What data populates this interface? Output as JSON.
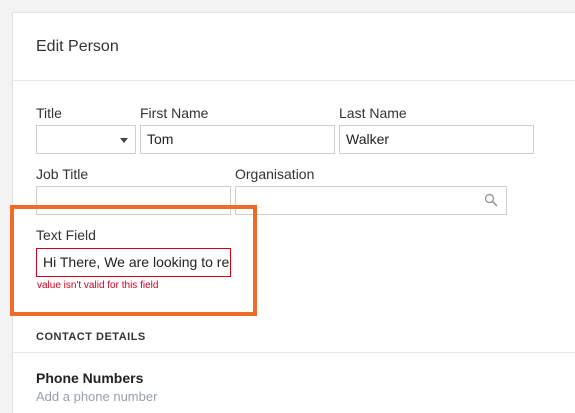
{
  "form": {
    "title": "Edit Person",
    "labels": {
      "title": "Title",
      "first_name": "First Name",
      "last_name": "Last Name",
      "job_title": "Job Title",
      "organisation": "Organisation",
      "text_field": "Text Field"
    },
    "values": {
      "title": "",
      "first_name": "Tom",
      "last_name": "Walker",
      "job_title": "",
      "organisation": "",
      "text_field": "Hi There,  We are looking to re"
    },
    "error_message": "value isn't valid for this field"
  },
  "contact": {
    "section_title": "CONTACT DETAILS",
    "phone_heading": "Phone Numbers",
    "add_phone": "Add a phone number"
  },
  "colors": {
    "highlight": "#f26a2a",
    "error": "#d0021b"
  }
}
